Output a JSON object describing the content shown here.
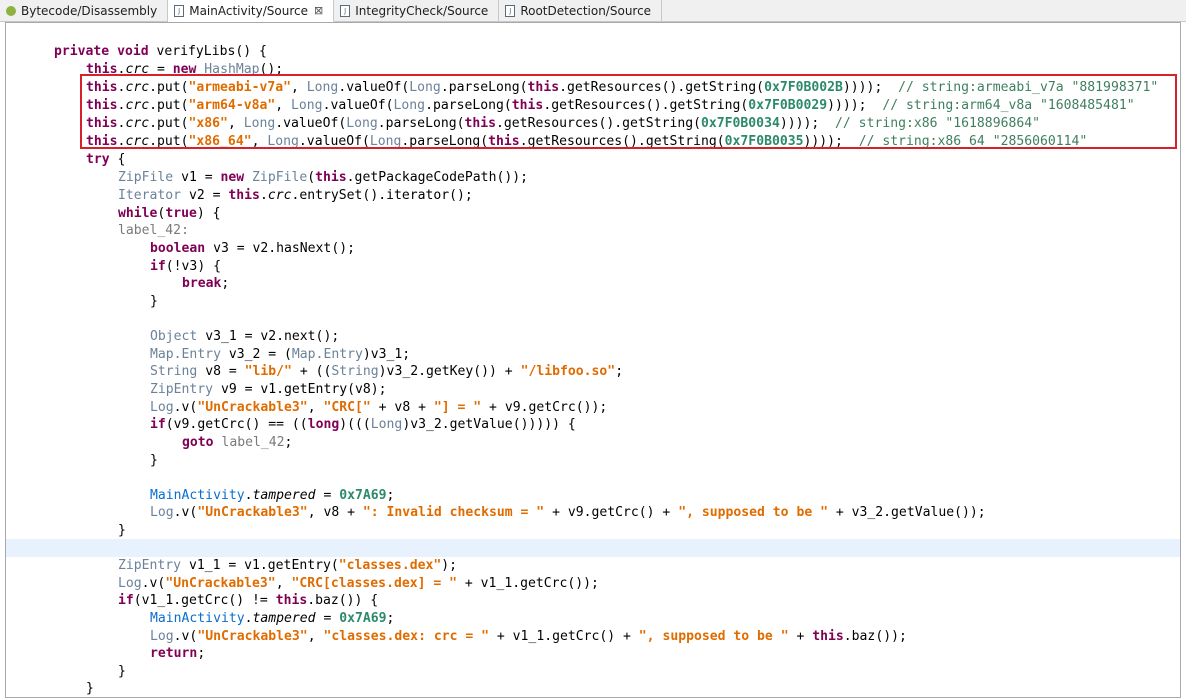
{
  "tabs": [
    {
      "label": "Bytecode/Disassembly",
      "icon": "android-icon",
      "active": false
    },
    {
      "label": "MainActivity/Source",
      "icon": "java-file-icon",
      "active": true,
      "close": "⊠"
    },
    {
      "label": "IntegrityCheck/Source",
      "icon": "java-file-icon",
      "active": false
    },
    {
      "label": "RootDetection/Source",
      "icon": "java-file-icon",
      "active": false
    }
  ],
  "code": {
    "l1": {
      "kw1": "private",
      "kw2": "void",
      "rest": " verifyLibs() {"
    },
    "l2": {
      "this": "this",
      "fld": "crc",
      "eq": " = ",
      "new": "new",
      "ty": "HashMap",
      "end": "();"
    },
    "puts": [
      {
        "arch": "\"armeabi-v7a\"",
        "res": "0x7F0B002B",
        "comment": "// string:armeabi_v7a \"881998371\""
      },
      {
        "arch": "\"arm64-v8a\"",
        "res": "0x7F0B0029",
        "comment": "// string:arm64_v8a \"1608485481\""
      },
      {
        "arch": "\"x86\"",
        "res": "0x7F0B0034",
        "comment": "// string:x86 \"1618896864\""
      },
      {
        "arch": "\"x86_64\"",
        "res": "0x7F0B0035",
        "comment": "// string:x86_64 \"2856060114\""
      }
    ],
    "put_parts": {
      "this": "this",
      "fld": "crc",
      "put": ".put(",
      "comma": ", ",
      "long": "Long",
      "vo": ".valueOf(",
      "pl": ".parseLong(",
      "gr": ".getResources().getString(",
      "end": "))));  "
    },
    "try": "try",
    "try_rest": " {",
    "zipfile": {
      "ty": "ZipFile",
      "mid": " v1 = ",
      "new": "new",
      "ty2": "ZipFile",
      "open": "(",
      "this": "this",
      "rest": ".getPackageCodePath());"
    },
    "iter": {
      "ty": "Iterator",
      "mid": " v2 = ",
      "this": "this",
      "dot": ".",
      "fld": "crc",
      "rest": ".entrySet().iterator();"
    },
    "while": {
      "kw": "while",
      "open": "(",
      "tr": "true",
      "rest": ") {"
    },
    "label42": "label_42:",
    "bool": {
      "kw": "boolean",
      "rest": " v3 = v2.hasNext();"
    },
    "if1": {
      "kw": "if",
      "rest": "(!v3) {"
    },
    "brk": {
      "kw": "break",
      "rest": ";"
    },
    "cb": "}",
    "obj": {
      "ty": "Object",
      "rest": " v3_1 = v2.next();"
    },
    "map": {
      "ty": "Map.Entry",
      "mid": " v3_2 = (",
      "ty2": "Map.Entry",
      "rest": ")v3_1;"
    },
    "str": {
      "ty": "String",
      "mid": " v8 = ",
      "s1": "\"lib/\"",
      "mid2": " + ((",
      "ty2": "String",
      "mid3": ")v3_2.getKey()) + ",
      "s2": "\"/libfoo.so\"",
      "end": ";"
    },
    "ze": {
      "ty": "ZipEntry",
      "rest": " v9 = v1.getEntry(v8);"
    },
    "log1": {
      "ty": "Log",
      "v": ".v(",
      "s1": "\"UnCrackable3\"",
      "c": ", ",
      "s2": "\"CRC[\"",
      "m": " + v8 + ",
      "s3": "\"] = \"",
      "rest": " + v9.getCrc());"
    },
    "if2": {
      "kw": "if",
      "a": "(v9.getCrc() == ((",
      "kw2": "long",
      "b": ")(((",
      "ty": "Long",
      "c": ")v3_2.getValue())))) {"
    },
    "goto": {
      "kw": "goto",
      "lb": " label_42",
      "end": ";"
    },
    "tamp1": {
      "ty": "MainActivity",
      "dot": ".",
      "fld": "tampered",
      "eq": " = ",
      "num": "0x7A69",
      "end": ";"
    },
    "log2": {
      "ty": "Log",
      "v": ".v(",
      "s1": "\"UnCrackable3\"",
      "m": ", v8 + ",
      "s2": "\": Invalid checksum = \"",
      "m2": " + v9.getCrc() + ",
      "s3": "\", supposed to be \"",
      "rest": " + v3_2.getValue());"
    },
    "ze2": {
      "ty": "ZipEntry",
      "mid": " v1_1 = v1.getEntry(",
      "s": "\"classes.dex\"",
      "end": ");"
    },
    "log3": {
      "ty": "Log",
      "v": ".v(",
      "s1": "\"UnCrackable3\"",
      "c": ", ",
      "s2": "\"CRC[classes.dex] = \"",
      "rest": " + v1_1.getCrc());"
    },
    "if3": {
      "kw": "if",
      "a": "(v1_1.getCrc() != ",
      "this": "this",
      "rest": ".baz()) {"
    },
    "log4": {
      "ty": "Log",
      "v": ".v(",
      "s1": "\"UnCrackable3\"",
      "c": ", ",
      "s2": "\"classes.dex: crc = \"",
      "m": " + v1_1.getCrc() + ",
      "s3": "\", supposed to be \"",
      "m2": " + ",
      "this": "this",
      "rest": ".baz());"
    },
    "ret": {
      "kw": "return",
      "end": ";"
    }
  },
  "colors": {
    "keyword": "#7f0055",
    "string": "#e06c00",
    "type": "#6b8299",
    "comment": "#3f7f5f",
    "highlight_box": "#d6202a",
    "current_line": "#e8f2fe"
  }
}
